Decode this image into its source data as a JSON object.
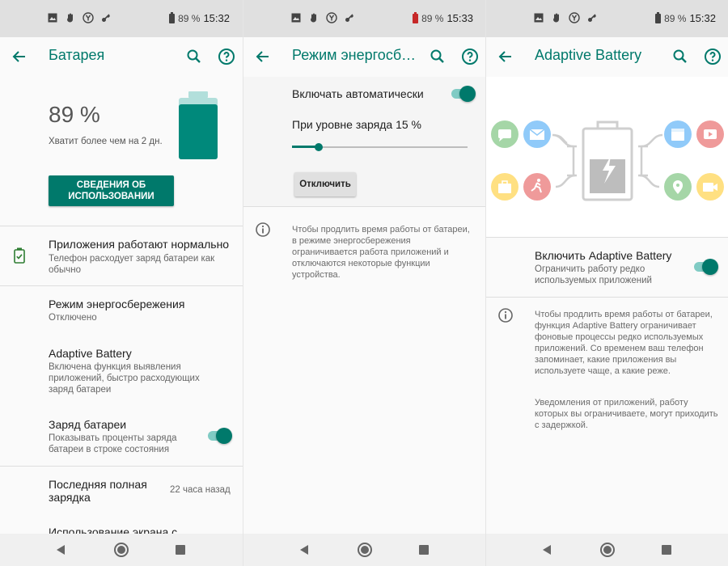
{
  "status": [
    {
      "percent": "89 %",
      "time": "15:32",
      "battery_state": "normal"
    },
    {
      "percent": "89 %",
      "time": "15:33",
      "battery_state": "low"
    },
    {
      "percent": "89 %",
      "time": "15:32",
      "battery_state": "normal"
    }
  ],
  "screen1": {
    "title": "Батарея",
    "level": "89 %",
    "level_fraction": 0.89,
    "remaining": "Хватит более чем на 2 дн.",
    "usage_button": "СВЕДЕНИЯ ОБ ИСПОЛЬЗОВАНИИ",
    "items": [
      {
        "title": "Приложения работают нормально",
        "subtitle": "Телефон расходует заряд батареи как обычно"
      },
      {
        "title": "Режим энергосбережения",
        "subtitle": "Отключено"
      },
      {
        "title": "Adaptive Battery",
        "subtitle": "Включена функция выявления приложений, быстро расходующих заряд батареи"
      },
      {
        "title": "Заряд батареи",
        "subtitle": "Показывать проценты заряда батареи в строке состояния",
        "toggle": true
      },
      {
        "title": "Последняя полная зарядка",
        "value": "22 часа назад"
      },
      {
        "title": "Использование экрана с"
      }
    ]
  },
  "screen2": {
    "title": "Режим энергосбе…",
    "auto_label": "Включать автоматически",
    "auto_toggle": true,
    "level_label": "При уровне заряда 15 %",
    "slider_fraction": 0.15,
    "disable_button": "Отключить",
    "info": "Чтобы продлить время работы от батареи, в режиме энергосбережения ограничивается работа приложений и отключаются некоторые функции устройства."
  },
  "screen3": {
    "title": "Adaptive Battery",
    "toggle_title": "Включить Adaptive Battery",
    "toggle_subtitle": "Ограничить работу редко используемых приложений",
    "toggle_on": true,
    "info1": "Чтобы продлить время работы от батареи, функция Adaptive Battery ограничивает фоновые процессы редко используемых приложений. Со временем ваш телефон запоминает, какие приложения вы используете чаще, а какие реже.",
    "info2": "Уведомления от приложений, работу которых вы ограничиваете, могут приходить с задержкой."
  },
  "colors": {
    "accent": "#00796b",
    "accent_light": "#80cbc4",
    "battery_green": "#00897b",
    "battery_cap": "#b2dfdb",
    "illus_green": "#a5d6a7",
    "illus_blue": "#90caf9",
    "illus_yellow": "#ffe082",
    "illus_red": "#ef9a9a"
  },
  "icons": {
    "statusbar": [
      "image-icon",
      "hand-icon",
      "yandex-icon",
      "key-icon"
    ],
    "appbar": [
      "back-arrow-icon",
      "search-icon",
      "help-icon"
    ],
    "illustration_left": [
      "chat-icon",
      "mail-icon",
      "briefcase-icon",
      "running-icon"
    ],
    "illustration_right": [
      "calendar-icon",
      "video-icon",
      "map-pin-icon",
      "camera-icon"
    ]
  }
}
